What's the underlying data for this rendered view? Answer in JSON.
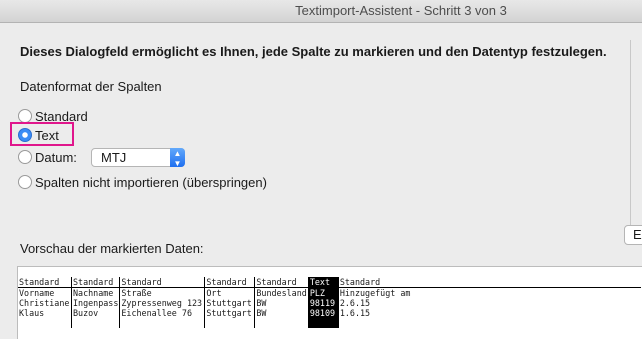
{
  "window": {
    "title": "Textimport-Assistent - Schritt 3 von 3"
  },
  "intro": "Dieses Dialogfeld ermöglicht es Ihnen, jede Spalte zu markieren und den Datentyp festzulegen.",
  "format_section": {
    "label": "Datenformat der Spalten",
    "options": [
      {
        "label": "Standard",
        "selected": false
      },
      {
        "label": "Text",
        "selected": true
      },
      {
        "label": "Datum:",
        "selected": false
      },
      {
        "label": "Spalten nicht importieren (überspringen)",
        "selected": false
      }
    ],
    "date_format": {
      "value": "MTJ"
    }
  },
  "edge_button": {
    "label": "E"
  },
  "preview": {
    "label": "Vorschau der markierten Daten:",
    "column_types": [
      "Standard",
      "Standard",
      "Standard",
      "Standard",
      "Standard",
      "Text",
      "Standard"
    ],
    "rows": [
      [
        "Vorname",
        "Nachname",
        "Straße",
        "Ort",
        "Bundesland",
        "PLZ",
        "Hinzugefügt am"
      ],
      [
        "Christiane",
        "Ingenpass",
        "Zypressenweg 123",
        "Stuttgart",
        "BW",
        "98119",
        "2.6.15"
      ],
      [
        "Klaus",
        "Buzov",
        "Eichenallee 76",
        "Stuttgart",
        "BW",
        "98109",
        "1.6.15"
      ]
    ],
    "selected_column": 5
  },
  "colors": {
    "highlight": "#e0168c",
    "accent": "#1f6ff0"
  },
  "icons": {
    "select_arrows": "updown-chevron-icon"
  }
}
